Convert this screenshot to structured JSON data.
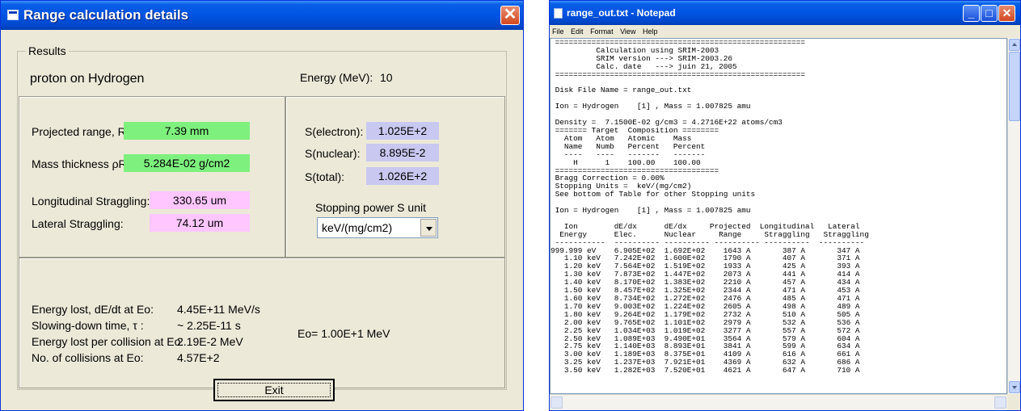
{
  "calc_window": {
    "title": "Range calculation details",
    "close_glyph": "✕",
    "results_legend": "Results",
    "ion_target": "proton on Hydrogen",
    "energy_label": "Energy (MeV):",
    "energy_value": "10",
    "projected_range_label": "Projected range, R:",
    "projected_range_value": "7.39 mm",
    "mass_thickness_label": "Mass thickness  ρR:",
    "mass_thickness_value": "5.284E-02  g/cm2",
    "long_straggling_label": "Longitudinal Straggling:",
    "long_straggling_value": "330.65 um",
    "lat_straggling_label": "Lateral Straggling:",
    "lat_straggling_value": "74.12 um",
    "s_electron_label": "S(electron):",
    "s_electron_value": "1.025E+2",
    "s_nuclear_label": "S(nuclear):",
    "s_nuclear_value": "8.895E-2",
    "s_total_label": "S(total):",
    "s_total_value": "1.026E+2",
    "stopping_unit_label": "Stopping power S unit",
    "stopping_unit_selected": "keV/(mg/cm2)",
    "energy_lost_label": "Energy lost, dE/dt at Eo:",
    "energy_lost_value": "4.45E+11 MeV/s",
    "slowing_down_label": "Slowing-down time, τ :",
    "slowing_down_value": "~ 2.25E-11 s",
    "energy_per_collision_label": "Energy lost per collision at Eo:",
    "energy_per_collision_value": "2.19E-2 MeV",
    "num_collisions_label": "No. of collisions at Eo:",
    "num_collisions_value": "4.57E+2",
    "eo_text": "Eo= 1.00E+1 MeV",
    "exit_label": "Exit",
    "colors": {
      "green": "#7ef07e",
      "pink": "#ffc6ff",
      "blue": "#c8c8f0"
    }
  },
  "notepad": {
    "title": "range_out.txt - Notepad",
    "min_glyph": "_",
    "max_glyph": "□",
    "close_glyph": "✕",
    "menu": [
      "File",
      "Edit",
      "Format",
      "View",
      "Help"
    ],
    "text": " =======================================================\n          Calculation using SRIM-2003\n          SRIM version ---> SRIM-2003.26\n          Calc. date   ---> juin 21, 2005\n =======================================================\n\n Disk File Name = range_out.txt\n\n Ion = Hydrogen    [1] , Mass = 1.007825 amu\n\n Density =  7.1500E-02 g/cm3 = 4.2716E+22 atoms/cm3\n ======= Target  Composition ========\n   Atom   Atom   Atomic    Mass\n   Name   Numb   Percent   Percent\n   ----   ----   -------   -------\n     H      1    100.00    100.00\n ====================================\n Bragg Correction = 0.00%\n Stopping Units =  keV/(mg/cm2)\n See bottom of Table for other Stopping units\n\n Ion = Hydrogen    [1] , Mass = 1.007825 amu\n\n   Ion        dE/dx      dE/dx     Projected  Longitudinal   Lateral\n  Energy      Elec.      Nuclear     Range     Straggling   Straggling\n -----------  ---------- ---------- ---------- ----------  ----------\n999.999 eV    6.905E+02  1.692E+02    1643 A       387 A       347 A\n   1.10 keV   7.242E+02  1.600E+02    1790 A       407 A       371 A\n   1.20 keV   7.564E+02  1.519E+02    1933 A       425 A       393 A\n   1.30 keV   7.873E+02  1.447E+02    2073 A       441 A       414 A\n   1.40 keV   8.170E+02  1.383E+02    2210 A       457 A       434 A\n   1.50 keV   8.457E+02  1.325E+02    2344 A       471 A       453 A\n   1.60 keV   8.734E+02  1.272E+02    2476 A       485 A       471 A\n   1.70 keV   9.003E+02  1.224E+02    2605 A       498 A       489 A\n   1.80 keV   9.264E+02  1.179E+02    2732 A       510 A       505 A\n   2.00 keV   9.765E+02  1.101E+02    2979 A       532 A       536 A\n   2.25 keV   1.034E+03  1.019E+02    3277 A       557 A       572 A\n   2.50 keV   1.089E+03  9.490E+01    3564 A       579 A       604 A\n   2.75 keV   1.140E+03  8.893E+01    3841 A       599 A       634 A\n   3.00 keV   1.189E+03  8.375E+01    4109 A       616 A       661 A\n   3.25 keV   1.237E+03  7.921E+01    4369 A       632 A       686 A\n   3.50 keV   1.282E+03  7.520E+01    4621 A       647 A       710 A"
  }
}
